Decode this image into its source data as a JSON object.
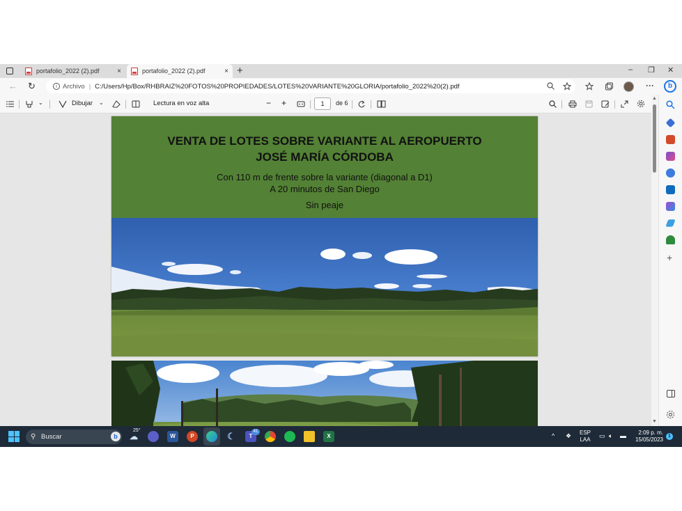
{
  "browser": {
    "tabs": [
      {
        "label": "portafolio_2022 (2).pdf",
        "close": "×"
      },
      {
        "label": "portafolio_2022 (2).pdf",
        "close": "×"
      }
    ],
    "new_tab": "+",
    "window_controls": {
      "minimize": "–",
      "restore": "❐",
      "close": "✕"
    },
    "address": {
      "back": "←",
      "refresh": "↻",
      "info_icon": "i",
      "site_label": "Archivo",
      "separator": "|",
      "url": "C:/Users/Hp/Box/RHBRAIZ%20FOTOS%20PROPIEDADES/LOTES%20VARIANTE%20GLORIA/portafolio_2022%20(2).pdf"
    },
    "toolbar_icons": [
      "zoom-icon",
      "favorite-add-icon",
      "favorites-icon",
      "collections-icon",
      "profile-avatar",
      "more-icon"
    ],
    "more": "···",
    "bing": "b"
  },
  "pdf_toolbar": {
    "draw_label": "Dibujar",
    "read_aloud_label": "Lectura en voz alta",
    "zoom_out": "−",
    "zoom_in": "+",
    "page_current": "1",
    "page_total": "de 6"
  },
  "document": {
    "title_line1": "VENTA DE LOTES SOBRE VARIANTE AL AEROPUERTO",
    "title_line2": "JOSÉ MARÍA CÓRDOBA",
    "line1": "Con 110 m de frente sobre la variante (diagonal a D1)",
    "line2": "A 20 minutos de San Diego",
    "line3": "Sin peaje",
    "band_color": "#538135"
  },
  "taskbar": {
    "search_label": "Buscar",
    "weather_temp": "25°",
    "teams_badge": "41",
    "language_top": "ESP",
    "language_bottom": "LAA",
    "time": "2:09 p. m.",
    "date": "15/05/2023",
    "notification_badge": "1"
  }
}
